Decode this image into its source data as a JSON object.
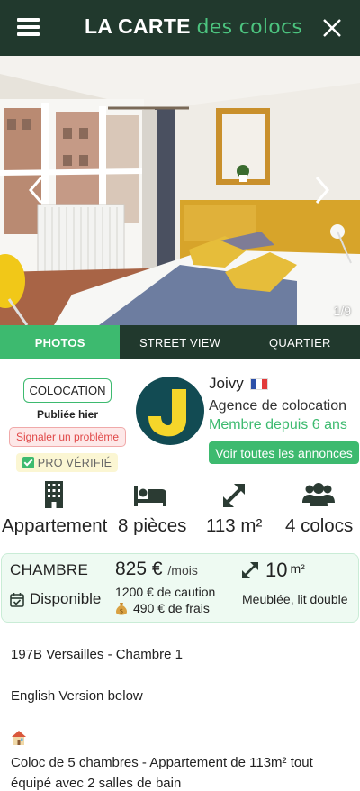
{
  "header": {
    "brand_main": "LA CARTE",
    "brand_accent": "des colocs"
  },
  "gallery": {
    "counter": "1/9"
  },
  "tabs": [
    "PHOTOS",
    "STREET VIEW",
    "QUARTIER"
  ],
  "listing": {
    "type_badge": "COLOCATION",
    "published": "Publiée hier",
    "report": "Signaler un problème",
    "verified": "PRO VÉRIFIÉ"
  },
  "agency": {
    "name": "Joivy",
    "type": "Agence de colocation",
    "since": "Membre depuis 6 ans",
    "all_ads": "Voir toutes les annonces"
  },
  "features": [
    {
      "icon": "building-icon",
      "label": "Appartement"
    },
    {
      "icon": "bed-icon",
      "label": "8 pièces"
    },
    {
      "icon": "area-icon",
      "label": "113 m²"
    },
    {
      "icon": "users-icon",
      "label": "4 colocs"
    }
  ],
  "room": {
    "title": "CHAMBRE",
    "availability": "Disponible",
    "price": "825 €",
    "price_unit": "/mois",
    "deposit": "1200 € de caution",
    "fees": "490 € de frais",
    "area": "10",
    "area_unit": "m²",
    "furnishing": "Meublée, lit double"
  },
  "description": {
    "line1": "197B Versailles - Chambre 1",
    "line2": "English Version below",
    "line3": "Coloc de 5 chambres - Appartement de 113m² tout équipé avec 2 salles de bain"
  },
  "colors": {
    "header_bg": "#21392d",
    "accent_green": "#3dba6f",
    "logo_bg": "#124b53",
    "logo_yellow": "#f5d62a"
  }
}
